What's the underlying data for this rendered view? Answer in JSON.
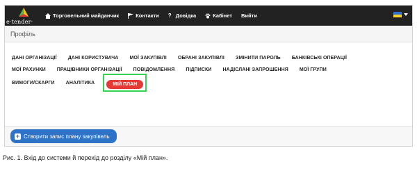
{
  "logo": {
    "text": "e·tender·"
  },
  "navbar": {
    "items": [
      {
        "icon": "home-icon",
        "glyph": "⌂",
        "label": "Торговельний майданчик"
      },
      {
        "icon": "flag-icon",
        "glyph": "⚑",
        "label": "Контакти"
      },
      {
        "icon": "question-icon",
        "glyph": "?",
        "label": "Довідка"
      },
      {
        "icon": "paw-icon",
        "glyph": "✿",
        "label": "Кабінет"
      },
      {
        "icon": "",
        "glyph": "",
        "label": "Вийти"
      }
    ],
    "language": {
      "flag_colors": [
        "#2f6fcf",
        "#f6d32a"
      ]
    }
  },
  "section": {
    "title": "Профіль"
  },
  "tabs": {
    "row1": [
      "ДАНІ ОРГАНІЗАЦІЇ",
      "ДАНІ КОРИСТУВАЧА",
      "МОЇ ЗАКУПІВЛІ",
      "ОБРАНІ ЗАКУПІВЛІ",
      "ЗМІНИТИ ПАРОЛЬ",
      "БАНКІВСЬКІ ОПЕРАЦІЇ"
    ],
    "row2": [
      "МОЇ РАХУНКИ",
      "ПРАЦІВНИКИ ОРГАНІЗАЦІЇ",
      "ПОВІДОМЛЕННЯ",
      "ПІДПИСКИ",
      "НАДІСЛАНІ ЗАПРОШЕННЯ",
      "МОЇ ГРУПИ"
    ],
    "row3": [
      "ВИМОГИ/СКАРГИ",
      "АНАЛІТИКА"
    ],
    "active": "МІЙ ПЛАН"
  },
  "actions": {
    "create_plan_label": "Створити запис плану закупівель"
  },
  "caption": "Рис. 1. Вхід до системи й перехід до розділу «Мій план».",
  "colors": {
    "navbar": "#222222",
    "active_tab": "#e53935",
    "highlight": "#39d353",
    "button": "#2f73c8"
  }
}
